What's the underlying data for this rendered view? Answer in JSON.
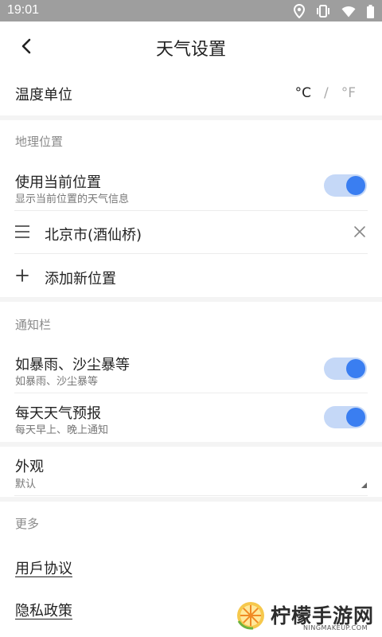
{
  "status_bar": {
    "time": "19:01",
    "icons": [
      "location-icon",
      "vibrate-icon",
      "wifi-icon",
      "battery-icon"
    ]
  },
  "header": {
    "title": "天气设置",
    "back_icon": "chevron-left-icon"
  },
  "temperature": {
    "label": "温度单位",
    "celsius": "°C",
    "separator": "/",
    "fahrenheit": "°F",
    "selected": "°C"
  },
  "location_section": {
    "title": "地理位置",
    "use_current": {
      "label": "使用当前位置",
      "description": "显示当前位置的天气信息",
      "enabled": true
    },
    "saved_locations": [
      {
        "name": "北京市(酒仙桥)"
      }
    ],
    "add_label": "添加新位置"
  },
  "notification_section": {
    "title": "通知栏",
    "items": [
      {
        "label": "如暴雨、沙尘暴等",
        "description": "如暴雨、沙尘暴等",
        "enabled": true
      },
      {
        "label": "每天天气预报",
        "description": "每天早上、晚上通知",
        "enabled": true
      }
    ]
  },
  "appearance": {
    "label": "外观",
    "value": "默认"
  },
  "more_section": {
    "title": "更多",
    "links": [
      "用戶协议",
      "隐私政策"
    ]
  },
  "watermark": {
    "text": "柠檬手游网",
    "sub": "NINGMAKEUP.COM"
  },
  "colors": {
    "accent": "#3a7ef1",
    "toggle_track": "#c5d8f7",
    "status_bar": "#9e9e9e"
  }
}
